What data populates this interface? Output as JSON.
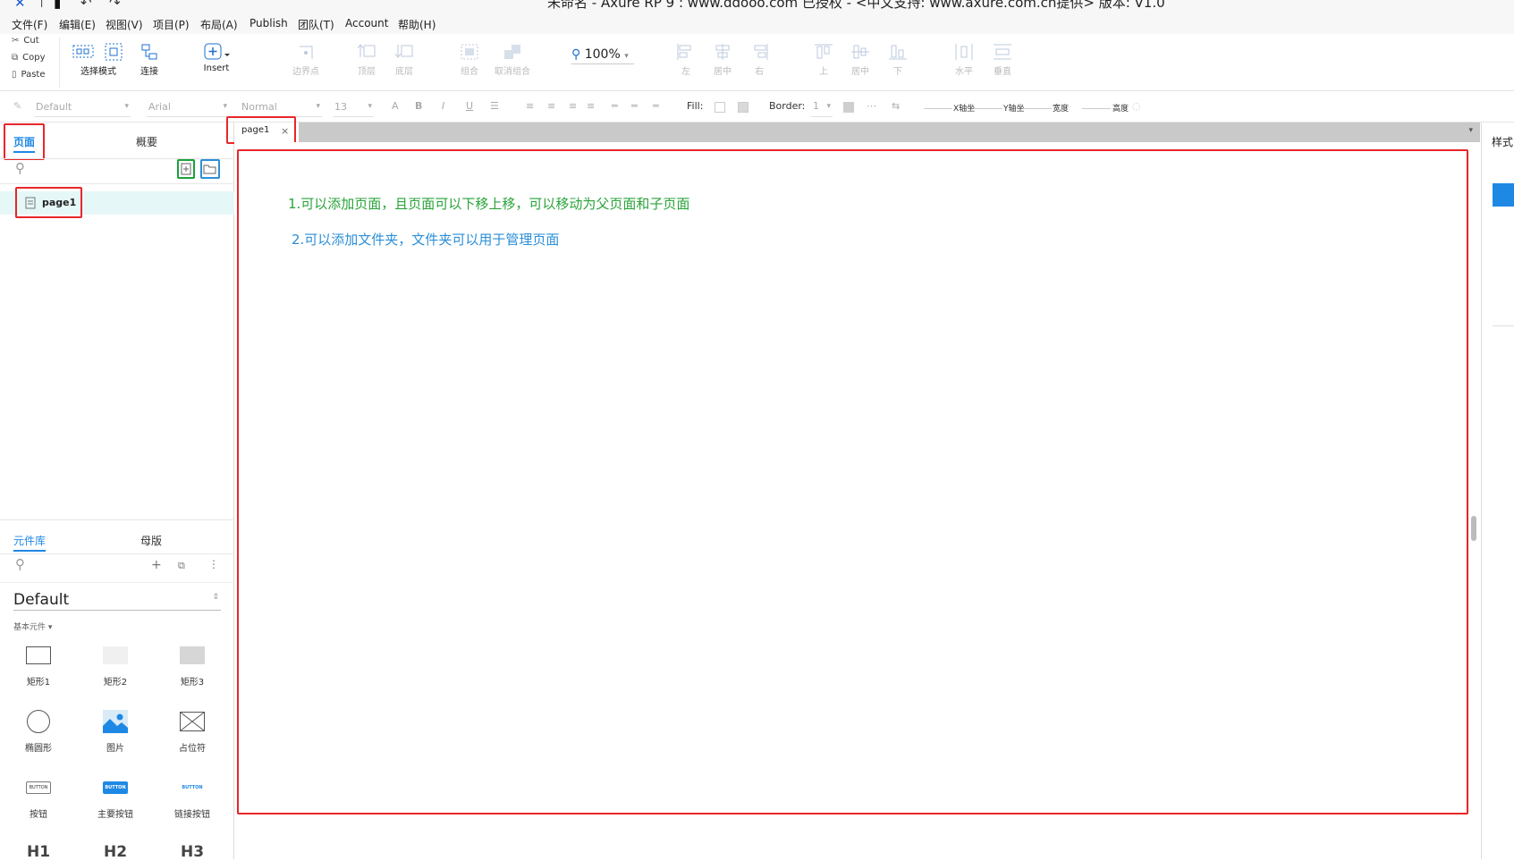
{
  "title_bar": {
    "title": "未命名 - Axure RP 9 : www.ddooo.com 已授权 - <中文支持: www.axure.com.cn提供> 版本: V1.0"
  },
  "menu": [
    "文件(F)",
    "编辑(E)",
    "视图(V)",
    "项目(P)",
    "布局(A)",
    "Publish",
    "团队(T)",
    "Account",
    "帮助(H)"
  ],
  "clipboard": {
    "cut": "Cut",
    "copy": "Copy",
    "paste": "Paste"
  },
  "toolbar": {
    "select_mode": "选择模式",
    "connect": "连接",
    "insert": "Insert",
    "points": "边界点",
    "top": "顶层",
    "bottom": "底层",
    "group": "组合",
    "ungroup": "取消组合",
    "zoom": "100%",
    "align_left": "左",
    "align_center": "居中",
    "align_right": "右",
    "align_top": "上",
    "align_middle": "居中",
    "align_bottom": "下",
    "dist_h": "水平",
    "dist_v": "垂直"
  },
  "formatbar": {
    "style": "Default",
    "font": "Arial",
    "weight": "Normal",
    "size": "13",
    "fill_label": "Fill:",
    "border_label": "Border:",
    "border_value": "1",
    "x_label": "X轴坐",
    "y_label": "Y轴坐",
    "w_label": "宽度",
    "h_label": "高度"
  },
  "pages_panel": {
    "tab_pages": "页面",
    "tab_outline": "概要",
    "pages": [
      "page1"
    ]
  },
  "library_panel": {
    "tab_library": "元件库",
    "tab_masters": "母版",
    "library_name": "Default",
    "section": "基本元件 ▾",
    "items": [
      "矩形1",
      "矩形2",
      "矩形3",
      "椭圆形",
      "图片",
      "占位符",
      "按钮",
      "主要按钮",
      "链接按钮"
    ],
    "headings": [
      "H1",
      "H2",
      "H3"
    ],
    "button_text": "BUTTON"
  },
  "canvas": {
    "tab": "page1",
    "note1": "1.可以添加页面，且页面可以下移上移，可以移动为父页面和子页面",
    "note2": "2.可以添加文件夹，文件夹可以用于管理页面"
  },
  "right_panel": {
    "tab_style": "样式"
  },
  "colors": {
    "accent": "#1e88e5",
    "highlight": "#e8262a",
    "note_green": "#2aa33a",
    "note_blue": "#2b8fd8",
    "green_box": "#1aa13a"
  }
}
